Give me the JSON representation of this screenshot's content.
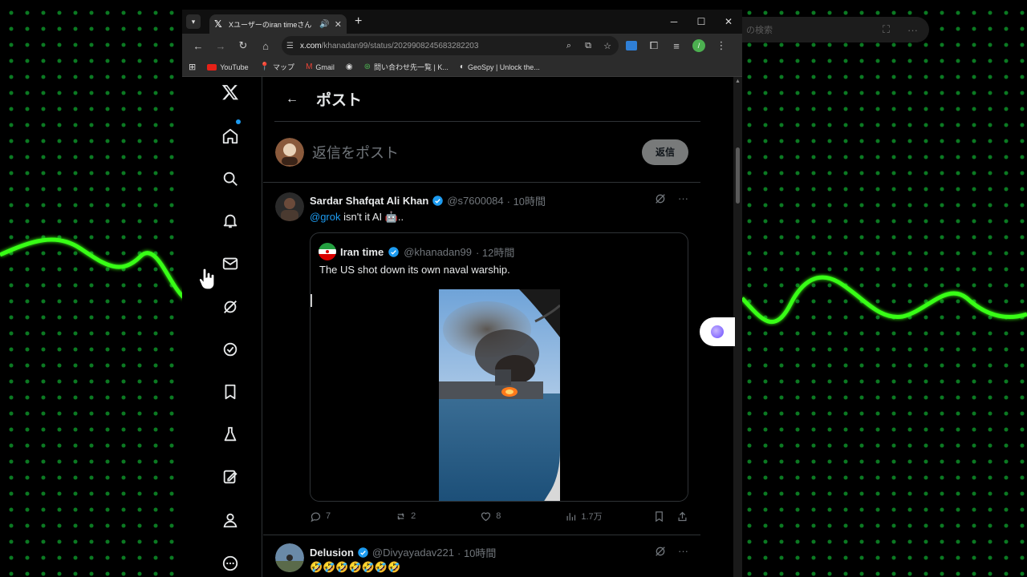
{
  "browser": {
    "tab_title": "Xユーザーのiran timeさん「The",
    "url_host": "x.com",
    "url_path": "/khanadan99/status/2029908245683282203",
    "bookmarks": [
      {
        "label": "YouTube",
        "icon": "youtube-icon"
      },
      {
        "label": "マップ",
        "icon": "maps-icon"
      },
      {
        "label": "Gmail",
        "icon": "gmail-icon"
      },
      {
        "label": "",
        "icon": "globe-icon"
      },
      {
        "label": "問い合わせ先一覧 | K...",
        "icon": "contact-icon"
      },
      {
        "label": "GeoSpy | Unlock the...",
        "icon": "geospy-icon"
      }
    ],
    "profile_initial": "/"
  },
  "background": {
    "search_text": "の検索"
  },
  "header": {
    "title": "ポスト"
  },
  "composer": {
    "placeholder": "返信をポスト",
    "reply_label": "返信"
  },
  "post": {
    "name": "Sardar Shafqat Ali Khan",
    "handle": "@s7600084",
    "time": "· 10時間",
    "mention": "@grok",
    "text": " isn't it AI 🤖..",
    "quote": {
      "name": "Iran time",
      "handle": "@khanadan99",
      "time": "· 12時間",
      "text": "The US shot down its own naval warship."
    },
    "stats": {
      "replies": "7",
      "reposts": "2",
      "likes": "8",
      "views": "1.7万"
    }
  },
  "next_post": {
    "name": "Delusion",
    "handle": "@Divyayadav221",
    "time": "· 10時間",
    "text": "🤣🤣🤣🤣🤣🤣🤣"
  },
  "colors": {
    "accent": "#1d9bf0",
    "verified": "#1d9bf0",
    "wave": "#39ff14",
    "dots": "#0b7a22"
  }
}
